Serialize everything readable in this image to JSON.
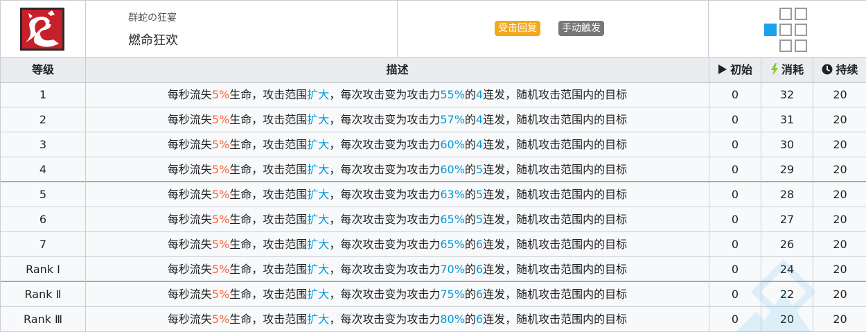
{
  "skill": {
    "subtitle": "群蛇の狂宴",
    "name": "燃命狂欢",
    "icon": "serpent-skill-icon",
    "tags": [
      "受击回复",
      "手动触发"
    ]
  },
  "range_grid": {
    "icon": "attack-range-grid",
    "active_color": "#1aa3ea"
  },
  "columns": {
    "level": "等级",
    "description": "描述",
    "initial": "初始",
    "cost": "消耗",
    "duration": "持续"
  },
  "desc_parts": {
    "p1": "每秒流失",
    "hp_loss": "5%",
    "p2": "生命，攻击范围",
    "range_up": "扩大",
    "p3": "，每次攻击变为攻击力",
    "p4": "的",
    "p5": "连发，随机攻击范围内的目标"
  },
  "rows": [
    {
      "level": "1",
      "atk": "55%",
      "hits": "4",
      "initial": "0",
      "cost": "32",
      "duration": "20"
    },
    {
      "level": "2",
      "atk": "57%",
      "hits": "4",
      "initial": "0",
      "cost": "31",
      "duration": "20"
    },
    {
      "level": "3",
      "atk": "60%",
      "hits": "4",
      "initial": "0",
      "cost": "30",
      "duration": "20"
    },
    {
      "level": "4",
      "atk": "60%",
      "hits": "5",
      "initial": "0",
      "cost": "29",
      "duration": "20"
    },
    {
      "level": "5",
      "atk": "63%",
      "hits": "5",
      "initial": "0",
      "cost": "28",
      "duration": "20"
    },
    {
      "level": "6",
      "atk": "65%",
      "hits": "5",
      "initial": "0",
      "cost": "27",
      "duration": "20"
    },
    {
      "level": "7",
      "atk": "65%",
      "hits": "6",
      "initial": "0",
      "cost": "26",
      "duration": "20"
    },
    {
      "level": "Rank Ⅰ",
      "atk": "70%",
      "hits": "6",
      "initial": "0",
      "cost": "24",
      "duration": "20"
    },
    {
      "level": "Rank Ⅱ",
      "atk": "75%",
      "hits": "6",
      "initial": "0",
      "cost": "22",
      "duration": "20"
    },
    {
      "level": "Rank Ⅲ",
      "atk": "80%",
      "hits": "6",
      "initial": "0",
      "cost": "20",
      "duration": "20"
    }
  ],
  "colors": {
    "hp_loss": "#ff6237",
    "highlight": "#0098dc",
    "tag_trigger": "#f4a81d",
    "tag_manual": "#777777"
  }
}
